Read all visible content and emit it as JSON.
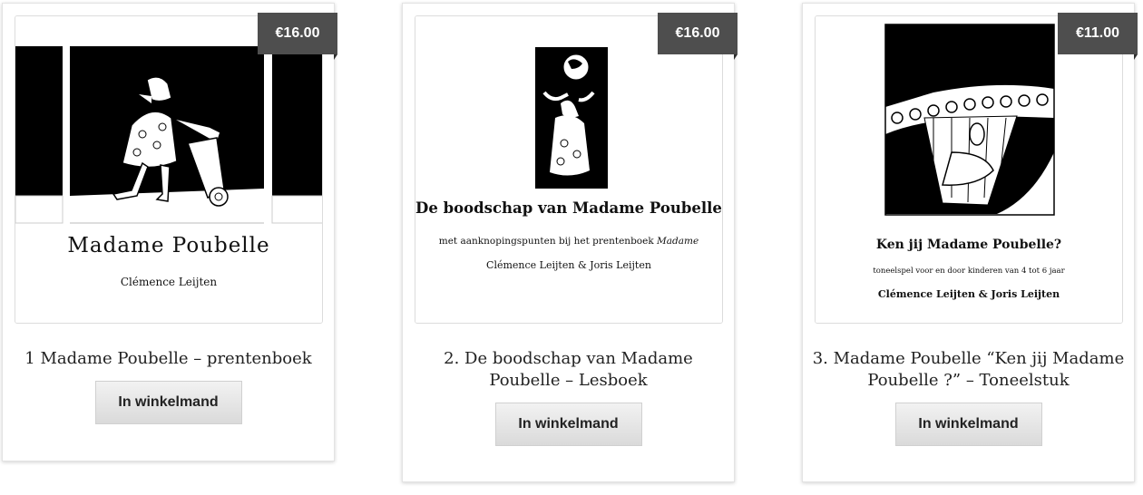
{
  "products": [
    {
      "price": "€16.00",
      "title": "1 Madame Poubelle – prentenboek",
      "button_label": "In winkelmand",
      "cover": {
        "title": "Madame Poubelle",
        "author": "Clémence Leijten"
      }
    },
    {
      "price": "€16.00",
      "title": "2. De boodschap van Madame Poubelle – Lesboek",
      "button_label": "In winkelmand",
      "cover": {
        "title": "De boodschap van Madame Poubelle",
        "subtitle": "met aanknopingspunten bij het prentenboek",
        "subtitle_em": "Madame",
        "author": "Clémence Leijten & Joris Leijten"
      }
    },
    {
      "price": "€11.00",
      "title": "3. Madame Poubelle “Ken jij Madame Poubelle ?” – Toneelstuk",
      "button_label": "In winkelmand",
      "cover": {
        "title": "Ken jij Madame Poubelle?",
        "subtitle": "toneelspel voor en door kinderen van 4 tot 6 jaar",
        "author": "Clémence Leijten & Joris Leijten"
      }
    }
  ]
}
